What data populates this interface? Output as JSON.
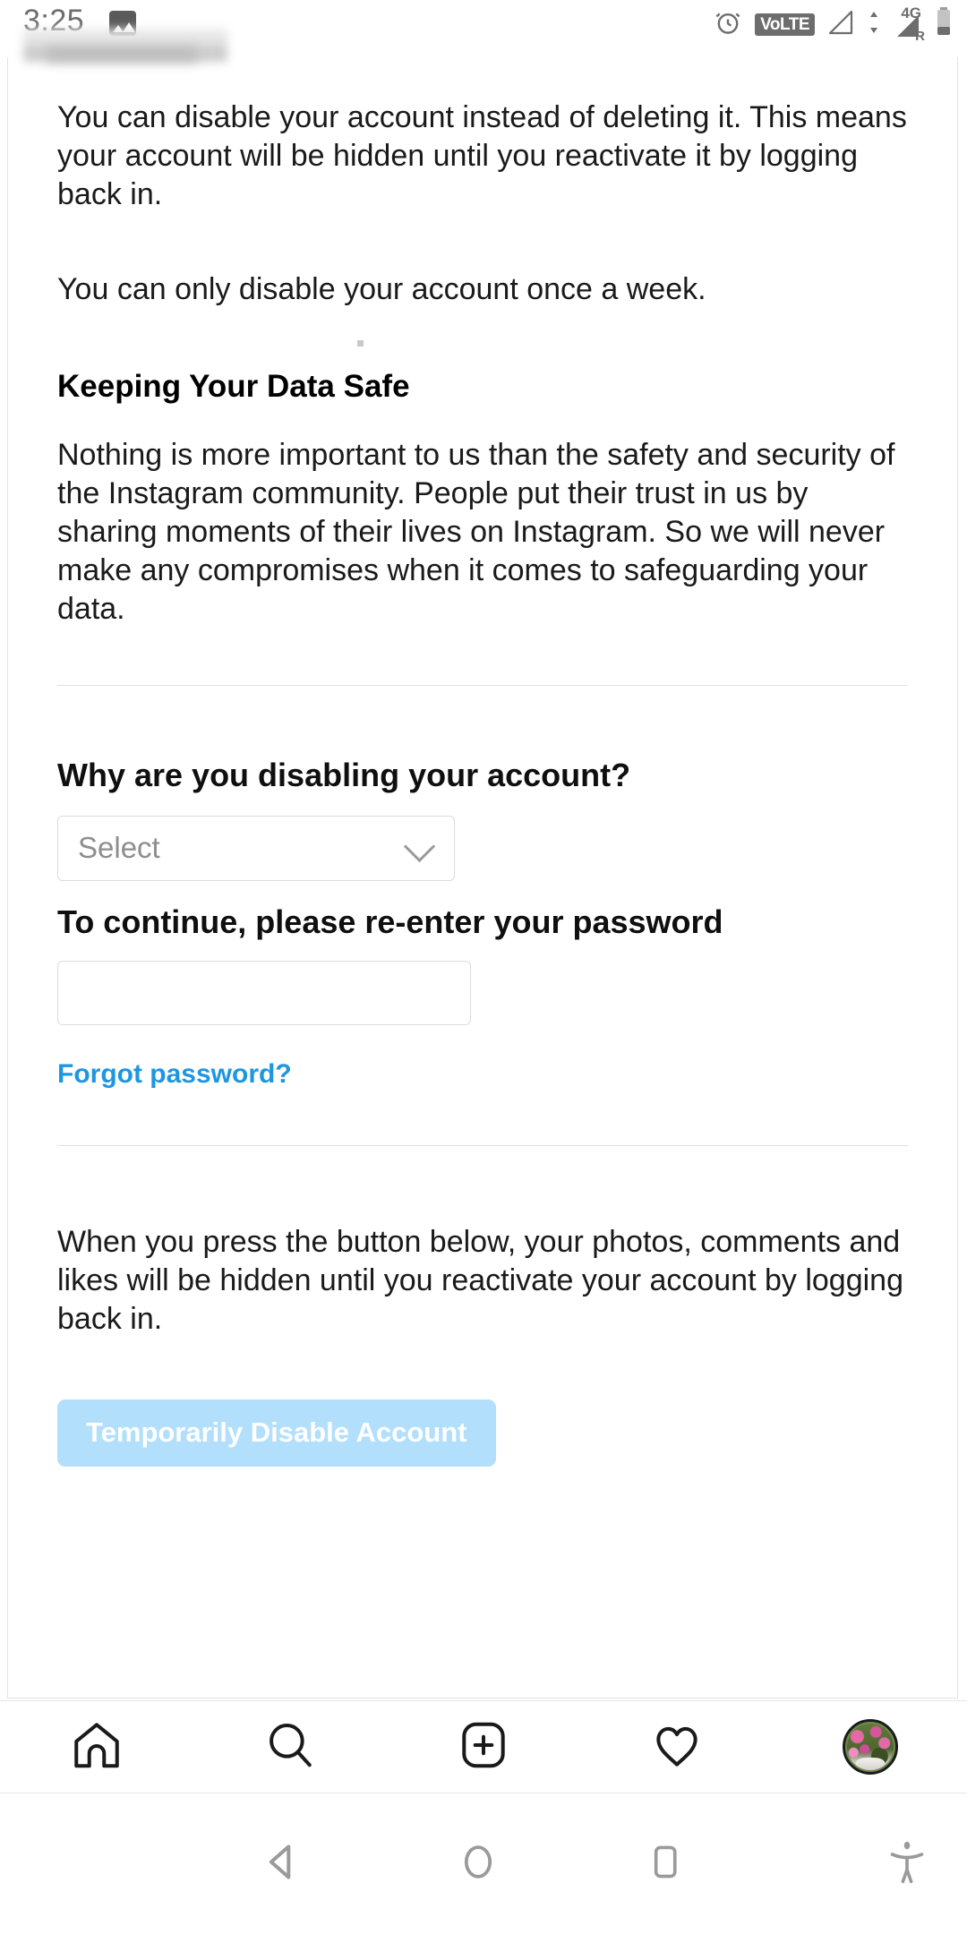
{
  "status_bar": {
    "time": "3:25",
    "left_icons": [
      "photo-icon"
    ],
    "right_icons": [
      "alarm-icon",
      "volte-badge",
      "signal-icon",
      "signal-4g-icon",
      "battery-icon"
    ],
    "volte_label": "VoLTE",
    "network_label": "4G",
    "roaming_label": "R"
  },
  "page": {
    "paragraph_1": "You can disable your account instead of deleting it. This means your account will be hidden until you reactivate it by logging back in.",
    "paragraph_2": "You can only disable your account once a week.",
    "heading_data_safe": "Keeping Your Data Safe",
    "paragraph_3": "Nothing is more important to us than the safety and security of the Instagram community. People put their trust in us by sharing moments of their lives on Instagram. So we will never make any compromises when it comes to safeguarding your data.",
    "form": {
      "reason_label": "Why are you disabling your account?",
      "reason_select_value": "Select",
      "reason_select_placeholder": "Select",
      "password_label": "To continue, please re-enter your password",
      "password_value": "",
      "password_placeholder": "",
      "forgot_password_link": "Forgot password?"
    },
    "paragraph_4": "When you press the button below, your photos, comments and likes will be hidden until you reactivate your account by logging back in.",
    "disable_button": "Temporarily Disable Account"
  },
  "tabbar": {
    "items": [
      {
        "name": "home",
        "label": "Home"
      },
      {
        "name": "search",
        "label": "Search"
      },
      {
        "name": "create",
        "label": "Create"
      },
      {
        "name": "activity",
        "label": "Activity"
      },
      {
        "name": "profile",
        "label": "Profile"
      }
    ]
  },
  "android_nav": {
    "items": [
      {
        "name": "back",
        "label": "Back"
      },
      {
        "name": "home",
        "label": "Home"
      },
      {
        "name": "recents",
        "label": "Recents"
      },
      {
        "name": "accessibility",
        "label": "Accessibility"
      }
    ]
  },
  "colors": {
    "link_blue": "#1f96e0",
    "button_disabled": "#b2dffc",
    "border_grey": "#dcdcdc",
    "text_primary": "#1a1a1a"
  }
}
